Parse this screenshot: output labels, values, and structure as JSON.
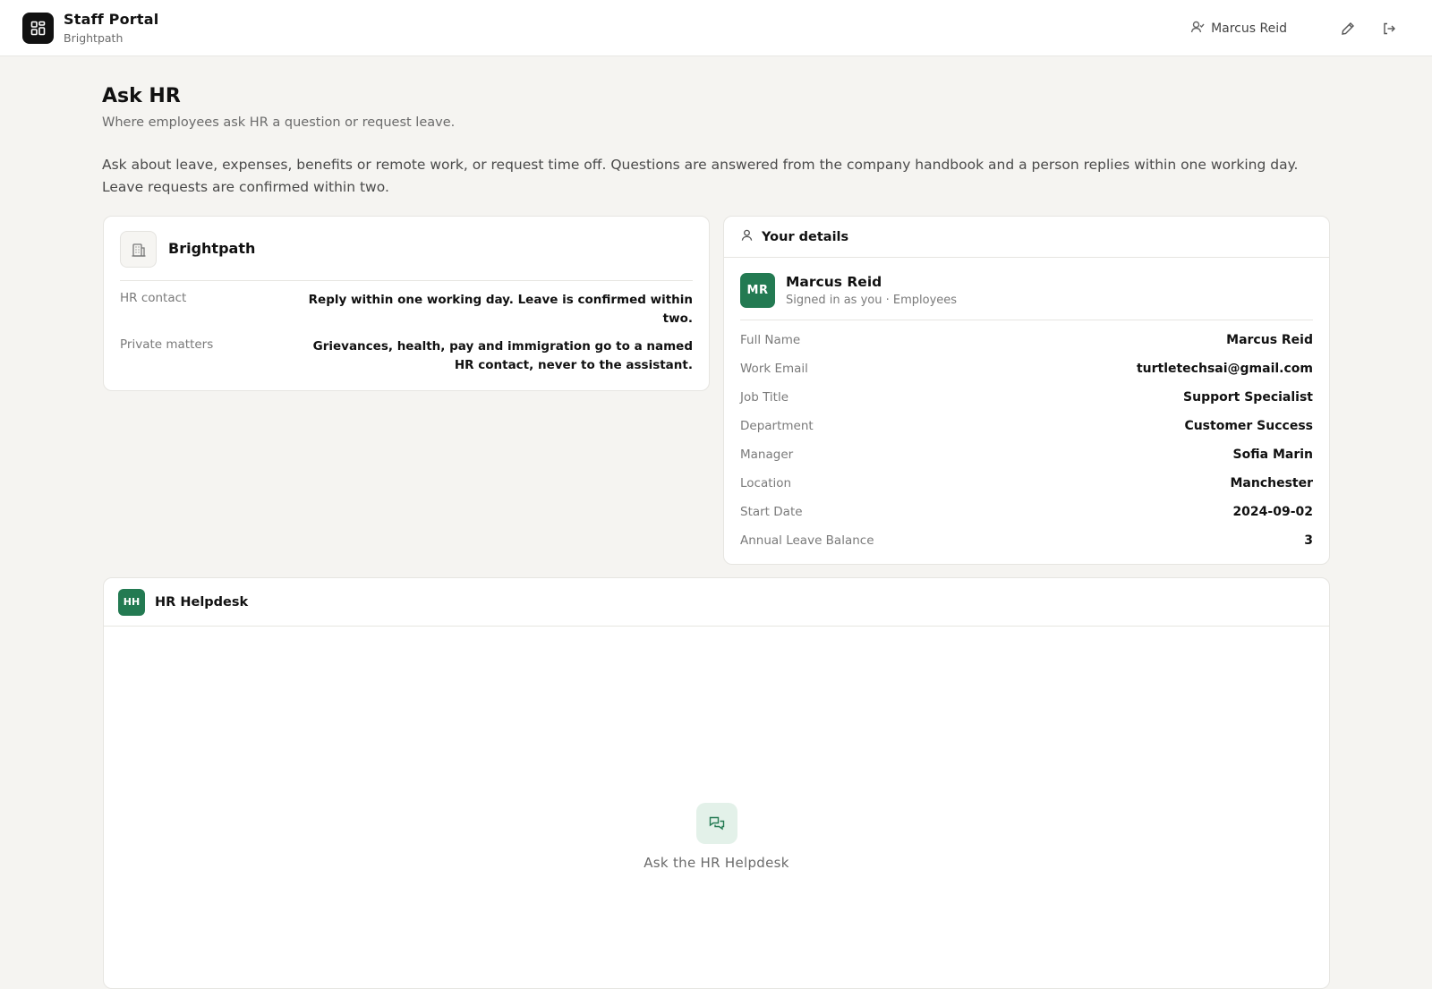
{
  "app": {
    "title": "Staff Portal",
    "subtitle": "Brightpath",
    "logo_icon": "grid-icon"
  },
  "header": {
    "user_name": "Marcus Reid",
    "user_icon": "user-icon",
    "edit_icon": "pencil-icon",
    "logout_icon": "logout-icon"
  },
  "page": {
    "title": "Ask HR",
    "subtitle": "Where employees ask HR a question or request leave.",
    "intro": "Ask about leave, expenses, benefits or remote work, or request time off. Questions are answered from the company handbook and a person replies within one working day. Leave requests are confirmed within two."
  },
  "org_card": {
    "name": "Brightpath",
    "icon": "building-icon",
    "rows": [
      {
        "label": "HR contact",
        "value": "Reply within one working day. Leave is confirmed within two."
      },
      {
        "label": "Private matters",
        "value": "Grievances, health, pay and immigration go to a named HR contact, never to the assistant."
      }
    ]
  },
  "details_card": {
    "title": "Your details",
    "icon": "user-icon",
    "avatar_initials": "MR",
    "name": "Marcus Reid",
    "meta": "Signed in as you · Employees",
    "fields": [
      {
        "label": "Full Name",
        "value": "Marcus Reid"
      },
      {
        "label": "Work Email",
        "value": "turtletechsai@gmail.com"
      },
      {
        "label": "Job Title",
        "value": "Support Specialist"
      },
      {
        "label": "Department",
        "value": "Customer Success"
      },
      {
        "label": "Manager",
        "value": "Sofia Marin"
      },
      {
        "label": "Location",
        "value": "Manchester"
      },
      {
        "label": "Start Date",
        "value": "2024-09-02"
      },
      {
        "label": "Annual Leave Balance",
        "value": "3"
      }
    ]
  },
  "helpdesk": {
    "badge": "HH",
    "title": "HR Helpdesk",
    "empty_icon": "chat-bubbles-icon",
    "empty_label": "Ask the HR Helpdesk"
  },
  "colors": {
    "accent": "#237a52",
    "accent_soft": "#e3f1e9",
    "background": "#f5f4f1",
    "logo_bg": "#111111"
  }
}
